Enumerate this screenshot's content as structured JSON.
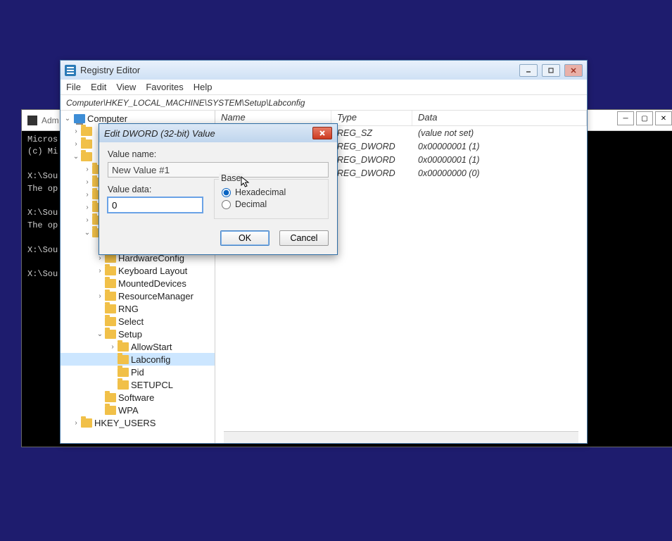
{
  "console": {
    "title": "Adm",
    "lines": "Micros\n(c) Mi\n\nX:\\Sou\nThe op\n\nX:\\Sou\nThe op\n\nX:\\Sou\n\nX:\\Sou"
  },
  "regedit": {
    "title": "Registry Editor",
    "menu": [
      "File",
      "Edit",
      "View",
      "Favorites",
      "Help"
    ],
    "path": "Computer\\HKEY_LOCAL_MACHINE\\SYSTEM\\Setup\\Labconfig",
    "columns": {
      "name": "Name",
      "type": "Type",
      "data": "Data"
    },
    "rows": [
      {
        "type": "REG_SZ",
        "data": "(value not set)"
      },
      {
        "type": "REG_DWORD",
        "data": "0x00000001 (1)"
      },
      {
        "type": "REG_DWORD",
        "data": "0x00000001 (1)"
      },
      {
        "type": "REG_DWORD",
        "data": "0x00000000 (0)"
      }
    ],
    "tree": {
      "root": "Computer",
      "tail": [
        "HardwareConfig",
        "Keyboard Layout",
        "MountedDevices",
        "ResourceManager",
        "RNG",
        "Select",
        "Setup",
        "AllowStart",
        "Labconfig",
        "Pid",
        "SETUPCL",
        "Software",
        "WPA",
        "HKEY_USERS"
      ]
    }
  },
  "dialog": {
    "title": "Edit DWORD (32-bit) Value",
    "labels": {
      "value_name": "Value name:",
      "value_data": "Value data:",
      "base": "Base",
      "hex": "Hexadecimal",
      "dec": "Decimal",
      "ok": "OK",
      "cancel": "Cancel"
    },
    "value_name": "New Value #1",
    "value_data": "0",
    "base_selected": "hex"
  }
}
